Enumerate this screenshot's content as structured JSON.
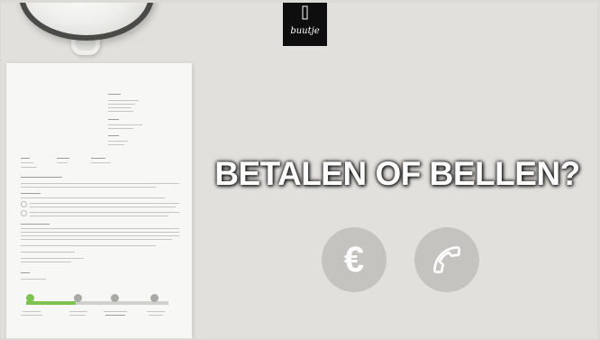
{
  "logo": {
    "text": "buutje"
  },
  "headline": "BETALEN OF BELLEN?",
  "actions": {
    "pay": {
      "symbol": "€",
      "icon": "euro-icon"
    },
    "call": {
      "icon": "phone-icon"
    }
  },
  "colors": {
    "background": "#e2e0dc",
    "button": "#c4c3bf",
    "progress_accent": "#7ec24f"
  },
  "letter": {
    "progress": 0.35
  }
}
